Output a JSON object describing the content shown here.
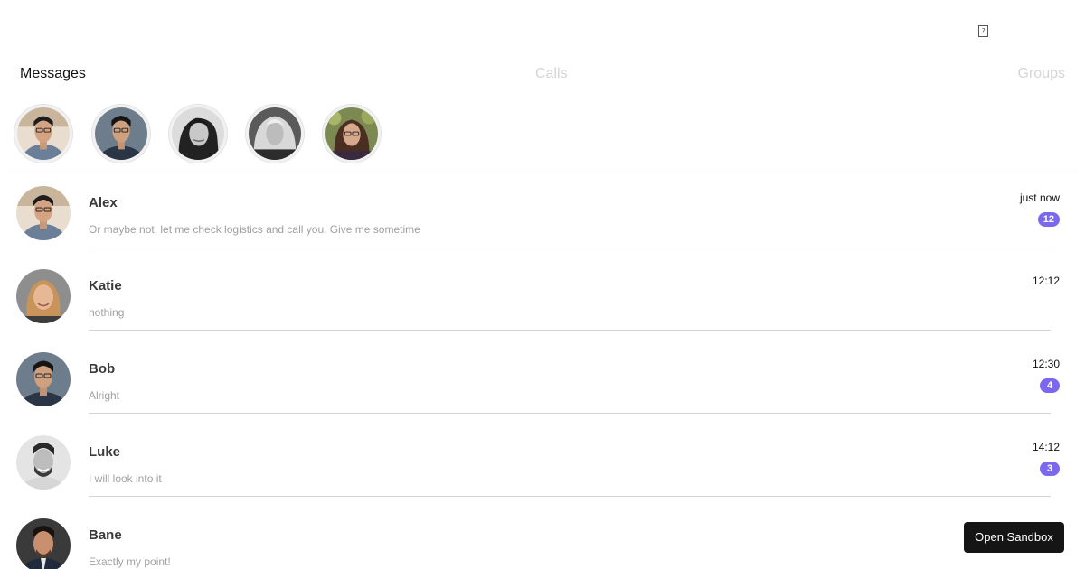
{
  "header": {
    "icon": "broken-image-icon"
  },
  "tabs": [
    {
      "label": "Messages",
      "active": true
    },
    {
      "label": "Calls",
      "active": false
    },
    {
      "label": "Groups",
      "active": false
    }
  ],
  "stories": [
    {
      "name": "story-avatar-1"
    },
    {
      "name": "story-avatar-2"
    },
    {
      "name": "story-avatar-3"
    },
    {
      "name": "story-avatar-4"
    },
    {
      "name": "story-avatar-5"
    }
  ],
  "conversations": [
    {
      "name": "Alex",
      "preview": "Or maybe not, let me check logistics and call you. Give me sometime",
      "time": "just now",
      "unread": "12"
    },
    {
      "name": "Katie",
      "preview": "nothing",
      "time": "12:12",
      "unread": ""
    },
    {
      "name": "Bob",
      "preview": "Alright",
      "time": "12:30",
      "unread": "4"
    },
    {
      "name": "Luke",
      "preview": "I will look into it",
      "time": "14:12",
      "unread": "3"
    },
    {
      "name": "Bane",
      "preview": "Exactly my point!",
      "time": "",
      "unread": ""
    }
  ],
  "sandbox_button": {
    "label": "Open Sandbox"
  },
  "colors": {
    "accent": "#7b68ee",
    "active_tab": "#111111",
    "inactive_tab": "#d5d5d5"
  }
}
